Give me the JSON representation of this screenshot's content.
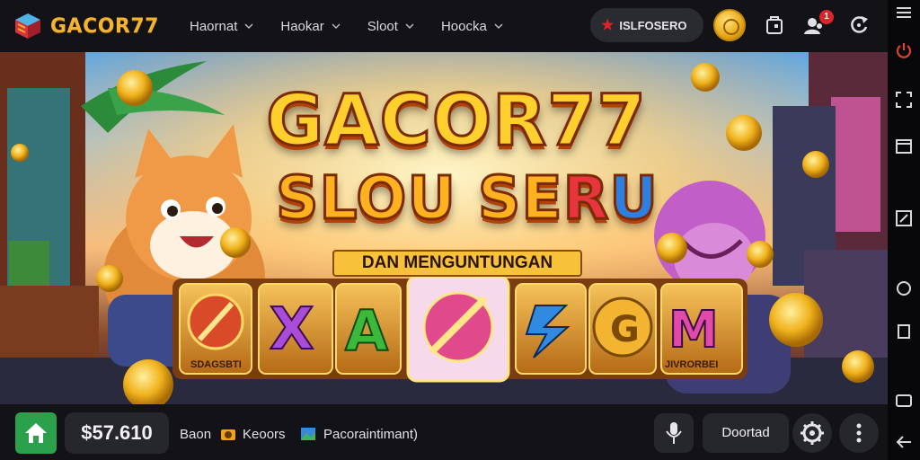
{
  "brand": {
    "name": "GACOR77"
  },
  "nav": [
    {
      "label": "Haornat"
    },
    {
      "label": "Haokar"
    },
    {
      "label": "Sloot"
    },
    {
      "label": "Hoocka"
    }
  ],
  "header": {
    "search_label": "ISLFOSERO",
    "notification_count": "1"
  },
  "banner": {
    "title_line1": "GACOR77",
    "title_line2_a": "SLOU SE",
    "title_line2_b": "R",
    "title_line2_c": "U",
    "subtitle": "DAN MENGUNTUNGAN",
    "reel_left_label": "SDAGSBTI",
    "reel_right_label": "JIVRORBEI"
  },
  "bottom": {
    "balance": "$57.610",
    "link1": "Baon",
    "link2": "Keoors",
    "link3": "Pacoraintimant)",
    "deposit_label": "Doortad"
  },
  "colors": {
    "brand_gold": "#f3b531",
    "home_green": "#2aa14a",
    "badge_red": "#e0222c",
    "system_accent": "#e0442a"
  }
}
